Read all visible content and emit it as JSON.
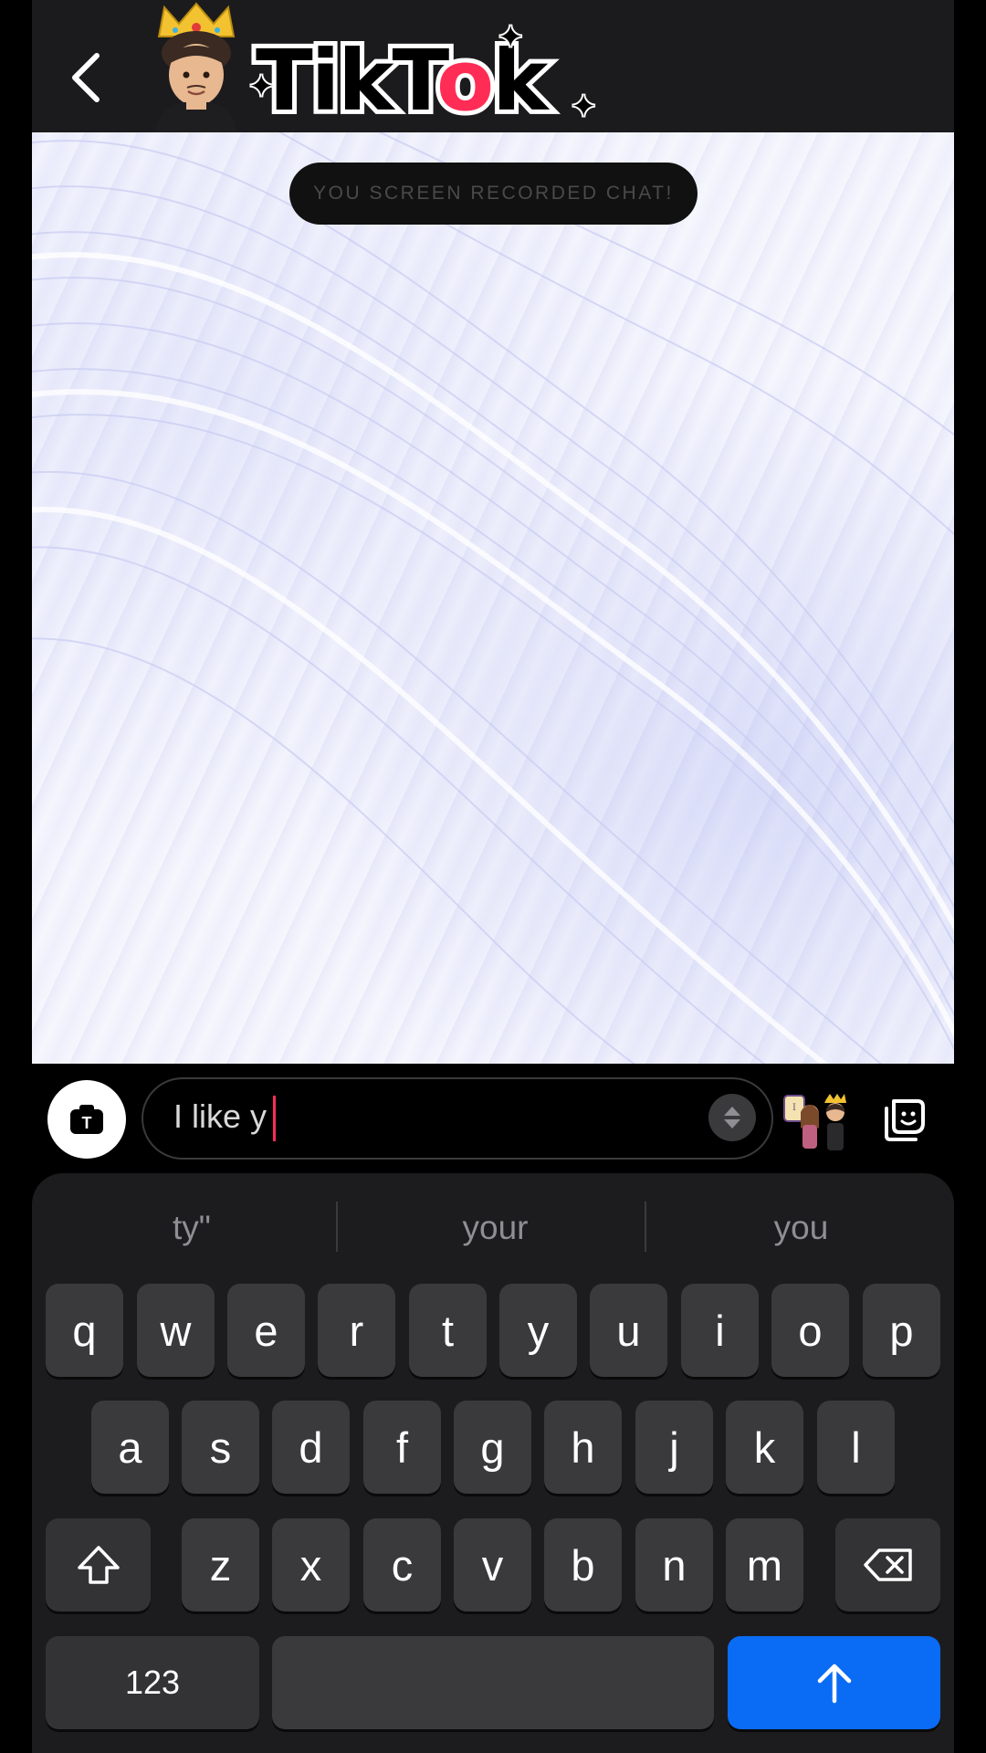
{
  "header": {
    "brand_text": "TikTok",
    "icons": {
      "back": "chevron-left-icon",
      "avatar": "bitmoji-king-avatar"
    }
  },
  "chat": {
    "banner": "YOU SCREEN RECORDED CHAT!"
  },
  "composer": {
    "message_value": "I like y",
    "icons": {
      "camera": "camera-icon",
      "stepper": "up-down-stepper-icon",
      "bitmoji": "bitmoji-pair-icon",
      "sticker": "sticker-icon"
    }
  },
  "keyboard": {
    "suggestions": [
      "ty\"",
      "your",
      "you"
    ],
    "row1": [
      "q",
      "w",
      "e",
      "r",
      "t",
      "y",
      "u",
      "i",
      "o",
      "p"
    ],
    "row2": [
      "a",
      "s",
      "d",
      "f",
      "g",
      "h",
      "j",
      "k",
      "l"
    ],
    "row3": [
      "z",
      "x",
      "c",
      "v",
      "b",
      "n",
      "m"
    ],
    "numbers_label": "123",
    "icons": {
      "shift": "shift-arrow-icon",
      "backspace": "backspace-icon",
      "send": "send-arrow-up-icon"
    }
  },
  "colors": {
    "accent_blue": "#0a6cf5",
    "caret_red": "#ff2d55",
    "key_bg": "#3a3a3c",
    "keyboard_bg": "#1c1c1e"
  }
}
